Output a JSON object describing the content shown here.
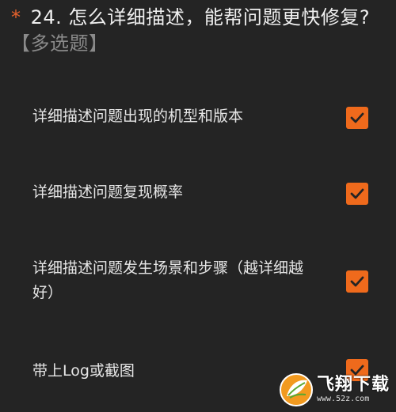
{
  "question": {
    "required_mark": "*",
    "text": " 24. 怎么详细描述，能帮问题更快修复?",
    "type_label": "【多选题】"
  },
  "options": [
    {
      "label": "详细描述问题出现的机型和版本",
      "checked": true
    },
    {
      "label": "详细描述问题复现概率",
      "checked": true
    },
    {
      "label": "详细描述问题发生场景和步骤（越详细越好）",
      "checked": true
    },
    {
      "label": "带上Log或截图",
      "checked": true
    }
  ],
  "colors": {
    "background": "#242424",
    "accent": "#ef6a1c",
    "required": "#e8622c"
  },
  "watermark": {
    "name": "飞翔下载",
    "url": "www.52z.com",
    "icon": "leaf-logo-icon"
  }
}
